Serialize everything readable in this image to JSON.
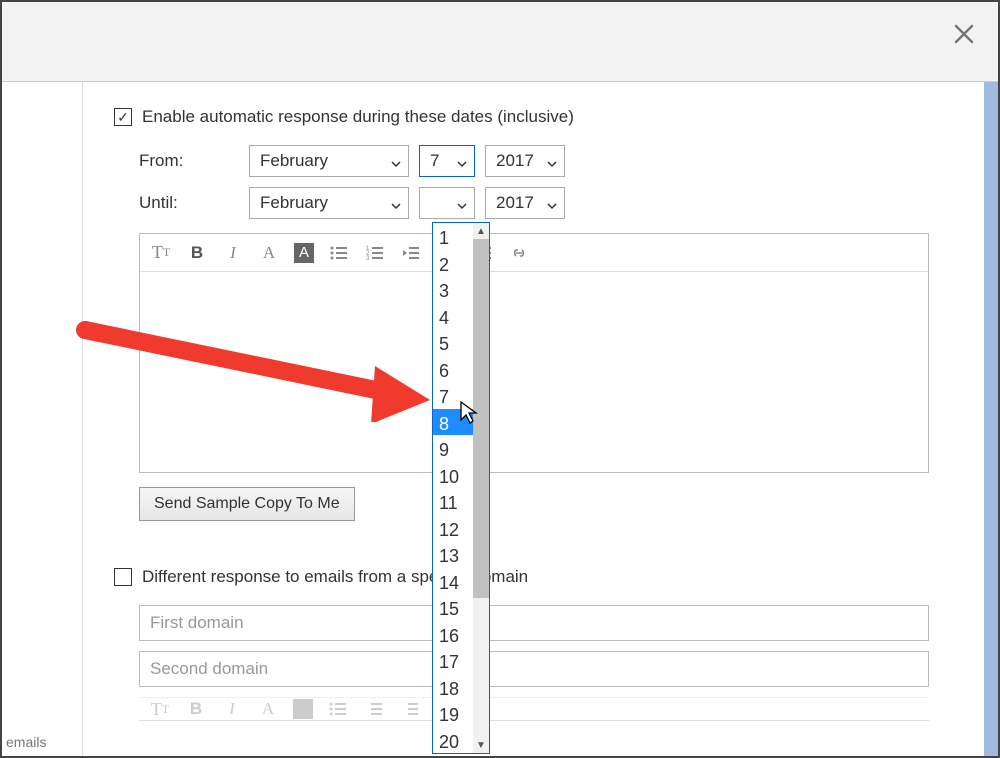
{
  "enable": {
    "label": "Enable automatic response during these dates (inclusive)",
    "checked": true
  },
  "from": {
    "label": "From:",
    "month": "February",
    "day": "7",
    "year": "2017"
  },
  "until": {
    "label": "Until:",
    "month": "February",
    "day": "",
    "year": "2017"
  },
  "dropdown": {
    "options": [
      "1",
      "2",
      "3",
      "4",
      "5",
      "6",
      "7",
      "8",
      "9",
      "10",
      "11",
      "12",
      "13",
      "14",
      "15",
      "16",
      "17",
      "18",
      "19",
      "20"
    ],
    "highlighted": "8"
  },
  "buttons": {
    "send_sample": "Send Sample Copy To Me"
  },
  "different_response": {
    "label": "Different response to emails from a specific domain",
    "checked": false
  },
  "placeholders": {
    "first_domain": "First domain",
    "second_domain": "Second domain"
  },
  "footer_label": "emails",
  "colors": {
    "highlight_blue": "#1e8cff",
    "accent_border": "#0a64c2",
    "arrow_red": "#f03a2d"
  }
}
